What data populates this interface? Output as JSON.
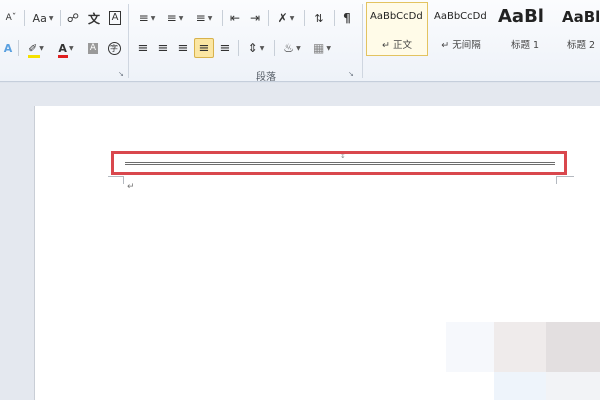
{
  "ribbon": {
    "font_group": {
      "grow_font": "A",
      "change_case": "Aa",
      "phonetic_guide": "文",
      "char_border": "A",
      "font_color_letter": "A",
      "char_shading": "A",
      "enclose_char": "字"
    },
    "paragraph_group": {
      "label": "段落"
    },
    "styles": [
      {
        "sample": "AaBbCcDd",
        "label": "↵ 正文"
      },
      {
        "sample": "AaBbCcDd",
        "label": "↵ 无间隔"
      },
      {
        "sample": "AaBl",
        "label": "标题 1"
      },
      {
        "sample": "AaBb",
        "label": "标题 2"
      }
    ]
  },
  "document": {
    "cursor_mark": "↕",
    "paragraph_mark": "↵"
  },
  "colors": {
    "highlight_border": "#d9474d",
    "font_color": "#e02020",
    "text_highlight": "#f5e100",
    "active_button": "#fbe6a3"
  }
}
